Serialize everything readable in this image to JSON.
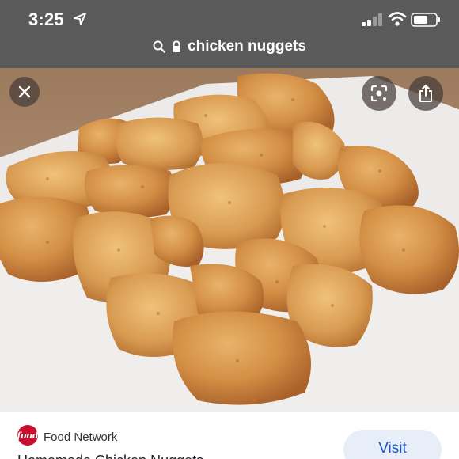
{
  "status_bar": {
    "time": "3:25",
    "icons": [
      "location-arrow-icon",
      "cellular-signal-icon",
      "wifi-icon",
      "battery-icon"
    ]
  },
  "address_bar": {
    "query": "chicken nuggets",
    "icons": [
      "search-icon",
      "lock-icon"
    ]
  },
  "image_viewer": {
    "image_subject": "",
    "buttons": [
      "close-icon",
      "lens-icon",
      "share-icon"
    ]
  },
  "result": {
    "source": "Food Network",
    "title": "Homemade Chicken Nuggets",
    "visit_label": "Visit"
  },
  "colors": {
    "top_bar": "#5a5a5a",
    "source_logo": "#c8102e",
    "visit_bg": "#e8eef8",
    "visit_text": "#1a56c4"
  }
}
